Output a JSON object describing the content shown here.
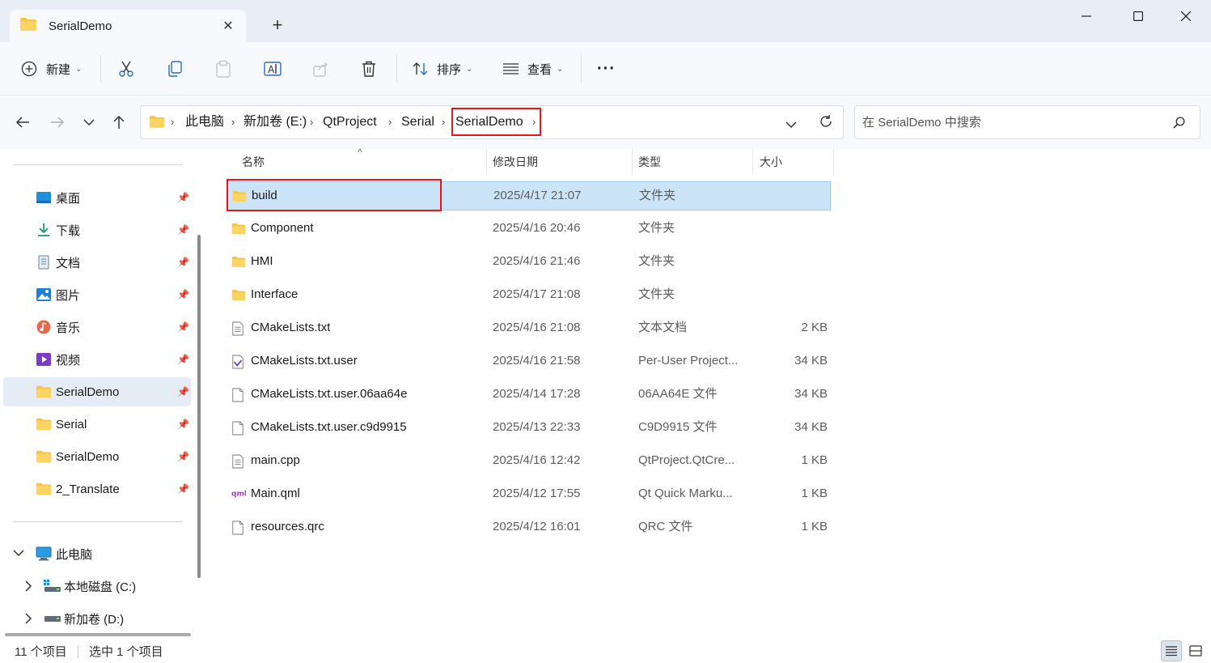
{
  "window": {
    "tab_title": "SerialDemo",
    "tab_close": "✕",
    "new_tab": "+"
  },
  "toolbar": {
    "new_label": "新建",
    "sort_label": "排序",
    "view_label": "查看",
    "more_label": "···"
  },
  "address": {
    "crumbs": [
      "此电脑",
      "新加卷 (E:)",
      "QtProject",
      "Serial",
      "SerialDemo"
    ]
  },
  "search": {
    "placeholder": "在 SerialDemo 中搜索"
  },
  "sidebar": {
    "quick_access": [
      {
        "label": "桌面",
        "icon": "desktop-icon"
      },
      {
        "label": "下载",
        "icon": "download-icon"
      },
      {
        "label": "文档",
        "icon": "document-icon"
      },
      {
        "label": "图片",
        "icon": "picture-icon"
      },
      {
        "label": "音乐",
        "icon": "music-icon"
      },
      {
        "label": "视频",
        "icon": "video-icon"
      },
      {
        "label": "SerialDemo",
        "icon": "folder-icon"
      },
      {
        "label": "Serial",
        "icon": "folder-icon"
      },
      {
        "label": "SerialDemo",
        "icon": "folder-icon"
      },
      {
        "label": "2_Translate",
        "icon": "folder-icon"
      }
    ],
    "this_pc": "此电脑",
    "drives": [
      {
        "label": "本地磁盘 (C:)"
      },
      {
        "label": "新加卷 (D:)"
      }
    ]
  },
  "columns": {
    "name": "名称",
    "date": "修改日期",
    "type": "类型",
    "size": "大小"
  },
  "files": [
    {
      "name": "build",
      "date": "2025/4/17 21:07",
      "type": "文件夹",
      "size": "",
      "icon": "folder-icon"
    },
    {
      "name": "Component",
      "date": "2025/4/16 20:46",
      "type": "文件夹",
      "size": "",
      "icon": "folder-icon"
    },
    {
      "name": "HMI",
      "date": "2025/4/16 21:46",
      "type": "文件夹",
      "size": "",
      "icon": "folder-icon"
    },
    {
      "name": "Interface",
      "date": "2025/4/17 21:08",
      "type": "文件夹",
      "size": "",
      "icon": "folder-icon"
    },
    {
      "name": "CMakeLists.txt",
      "date": "2025/4/16 21:08",
      "type": "文本文档",
      "size": "2 KB",
      "icon": "text-file-icon"
    },
    {
      "name": "CMakeLists.txt.user",
      "date": "2025/4/16 21:58",
      "type": "Per-User Project...",
      "size": "34 KB",
      "icon": "project-file-icon"
    },
    {
      "name": "CMakeLists.txt.user.06aa64e",
      "date": "2025/4/14 17:28",
      "type": "06AA64E 文件",
      "size": "34 KB",
      "icon": "blank-file-icon"
    },
    {
      "name": "CMakeLists.txt.user.c9d9915",
      "date": "2025/4/13 22:33",
      "type": "C9D9915 文件",
      "size": "34 KB",
      "icon": "blank-file-icon"
    },
    {
      "name": "main.cpp",
      "date": "2025/4/16 12:42",
      "type": "QtProject.QtCre...",
      "size": "1 KB",
      "icon": "text-file-icon"
    },
    {
      "name": "Main.qml",
      "date": "2025/4/12 17:55",
      "type": "Qt Quick Marku...",
      "size": "1 KB",
      "icon": "qml-file-icon"
    },
    {
      "name": "resources.qrc",
      "date": "2025/4/12 16:01",
      "type": "QRC 文件",
      "size": "1 KB",
      "icon": "blank-file-icon"
    }
  ],
  "status": {
    "count": "11 个项目",
    "selected": "选中 1 个项目"
  },
  "colors": {
    "folder": "#f8c443",
    "selection": "#cce4f7",
    "highlight_box": "#e8161c"
  }
}
